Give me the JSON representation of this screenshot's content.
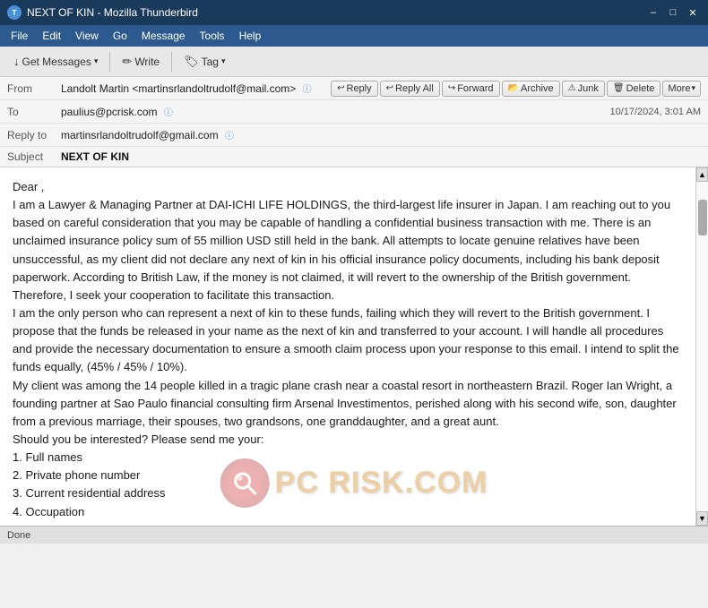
{
  "window": {
    "title": "NEXT OF KIN - Mozilla Thunderbird",
    "app_icon": "T"
  },
  "menu": {
    "items": [
      "File",
      "Edit",
      "View",
      "Go",
      "Message",
      "Tools",
      "Help"
    ]
  },
  "toolbar": {
    "get_messages_label": "Get Messages",
    "write_label": "Write",
    "tag_label": "Tag"
  },
  "email_actions": {
    "reply_label": "Reply",
    "reply_all_label": "Reply All",
    "forward_label": "Forward",
    "archive_label": "Archive",
    "junk_label": "Junk",
    "delete_label": "Delete",
    "more_label": "More"
  },
  "header": {
    "from_label": "From",
    "from_value": "Landolt Martin <martinsrlandoltrudolf@mail.com>",
    "to_label": "To",
    "to_value": "paulius@pcrisk.com",
    "reply_to_label": "Reply to",
    "reply_to_value": "martinsrlandoltrudolf@gmail.com",
    "subject_label": "Subject",
    "subject_value": "NEXT OF KIN",
    "date": "10/17/2024, 3:01 AM"
  },
  "body": {
    "greeting": "Dear ,",
    "paragraph1": "I am a Lawyer & Managing Partner at DAI-ICHI LIFE HOLDINGS, the third-largest life insurer in Japan. I am reaching out to you based on careful consideration that you may be capable of handling a confidential business transaction with me. There is an unclaimed insurance policy sum of 55 million USD still held in the bank. All attempts to locate genuine relatives have been unsuccessful, as my client did not declare any next of kin in his official insurance policy documents, including his bank deposit paperwork. According to British Law, if the money is not claimed, it will revert to the ownership of the British government. Therefore, I seek your cooperation to facilitate this transaction.",
    "paragraph2": "I am the only person who can represent a next of kin to these funds, failing which they will revert to the British government. I propose that the funds be released in your name as the next of kin and transferred to your account. I will handle all procedures and provide the necessary documentation to ensure a smooth claim process upon your response to this email. I intend to split the funds equally, (45% / 45% / 10%).",
    "paragraph3": "My client was among the 14 people killed in a tragic plane crash near a coastal resort in northeastern Brazil. Roger Ian Wright, a founding partner at Sao Paulo financial consulting firm Arsenal Investimentos, perished along with his second wife, son, daughter from a previous marriage, their spouses, two grandsons, one granddaughter, and a great aunt.",
    "paragraph4": "Should you be interested? Please send me your:",
    "list_intro": "Should you be interested? Please send me your:",
    "list_items": [
      "1. Full names",
      "2. Private phone number",
      "3. Current residential address",
      "4. Occupation"
    ]
  },
  "status": {
    "text": "Done"
  },
  "watermark": {
    "text": "PC RISK.COM"
  }
}
